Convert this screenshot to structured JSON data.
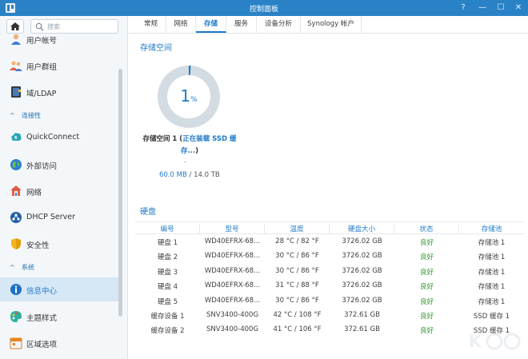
{
  "window": {
    "title": "控制面板",
    "controls": [
      "?",
      "—",
      "☐",
      "✕"
    ]
  },
  "sidebar": {
    "search_placeholder": "搜索",
    "items": [
      {
        "label": "用户帐号",
        "icon": "user-icon"
      },
      {
        "label": "用户群组",
        "icon": "user-group-icon"
      },
      {
        "label": "域/LDAP",
        "icon": "domain-book-icon"
      },
      {
        "label": "QuickConnect",
        "icon": "quickconnect-icon"
      },
      {
        "label": "外部访问",
        "icon": "globe-icon"
      },
      {
        "label": "网络",
        "icon": "network-house-icon"
      },
      {
        "label": "DHCP Server",
        "icon": "dhcp-server-icon"
      },
      {
        "label": "安全性",
        "icon": "shield-icon"
      },
      {
        "label": "信息中心",
        "icon": "info-icon"
      },
      {
        "label": "主题样式",
        "icon": "palette-icon"
      },
      {
        "label": "区域选项",
        "icon": "calendar-icon"
      }
    ],
    "sections": [
      "连接性",
      "系统"
    ]
  },
  "tabs": [
    "常规",
    "网络",
    "存储",
    "服务",
    "设备分析",
    "Synology 帐户"
  ],
  "active_tab": "存储",
  "storage": {
    "section_title": "存储空间",
    "usage_number": "1",
    "usage_symbol": "%",
    "usage_fraction": 0.01,
    "volume_name": "存储空间 1 (",
    "volume_status": "正在装载 SSD 缓存...",
    "volume_close": ")",
    "volume_dash": "-",
    "used": "60.0 MB",
    "separator": " / ",
    "total": "14.0 TB"
  },
  "disks": {
    "section_title": "硬盘",
    "columns": [
      "编号",
      "型号",
      "温度",
      "硬盘大小",
      "状态",
      "存储池"
    ],
    "rows": [
      [
        "硬盘 1",
        "WD40EFRX-68...",
        "28 °C / 82 °F",
        "3726.02 GB",
        "良好",
        "存储池 1"
      ],
      [
        "硬盘 2",
        "WD40EFRX-68...",
        "30 °C / 86 °F",
        "3726.02 GB",
        "良好",
        "存储池 1"
      ],
      [
        "硬盘 3",
        "WD40EFRX-68...",
        "30 °C / 86 °F",
        "3726.02 GB",
        "良好",
        "存储池 1"
      ],
      [
        "硬盘 4",
        "WD40EFRX-68...",
        "31 °C / 88 °F",
        "3726.02 GB",
        "良好",
        "存储池 1"
      ],
      [
        "硬盘 5",
        "WD40EFRX-68...",
        "30 °C / 86 °F",
        "3726.02 GB",
        "良好",
        "存储池 1"
      ],
      [
        "缓存设备 1",
        "SNV3400-400G",
        "42 °C / 108 °F",
        "372.61 GB",
        "良好",
        "SSD 缓存 1"
      ],
      [
        "缓存设备 2",
        "SNV3400-400G",
        "41 °C / 106 °F",
        "372.61 GB",
        "良好",
        "SSD 缓存 1"
      ]
    ]
  },
  "colors": {
    "accent": "#1f7ac8",
    "titlebar": "#2a82c6",
    "good": "#2e9b2e",
    "donut_track": "#d3dbe3"
  }
}
